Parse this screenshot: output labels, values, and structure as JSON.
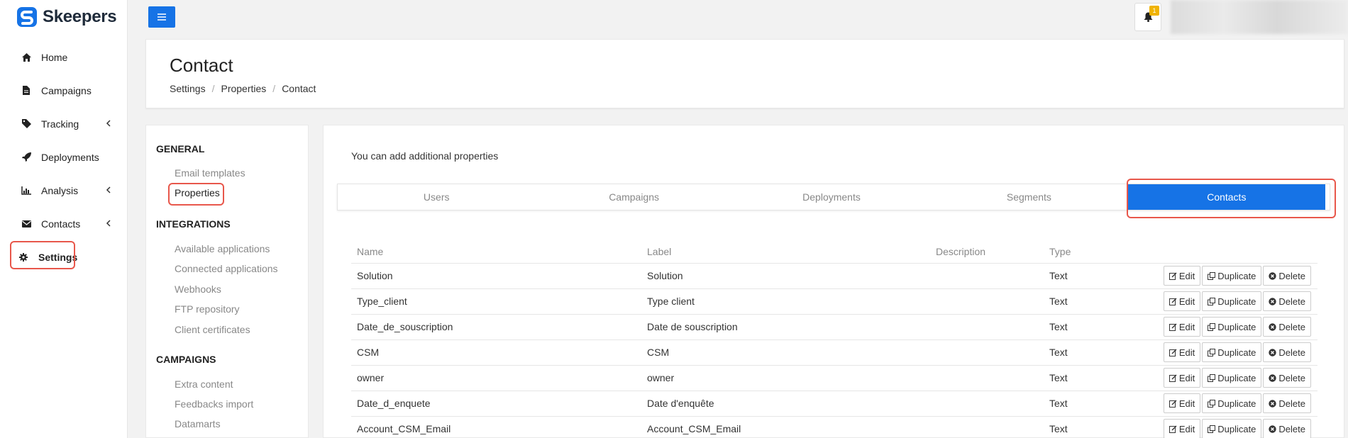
{
  "app": {
    "brand": "Skeepers",
    "accent": "#1673e6",
    "highlight": "#e8574b"
  },
  "sidebar": {
    "items": [
      {
        "label": "Home",
        "icon": "home-icon"
      },
      {
        "label": "Campaigns",
        "icon": "file-icon"
      },
      {
        "label": "Tracking",
        "icon": "tag-icon",
        "expandable": true
      },
      {
        "label": "Deployments",
        "icon": "rocket-icon"
      },
      {
        "label": "Analysis",
        "icon": "bar-chart-icon",
        "expandable": true
      },
      {
        "label": "Contacts",
        "icon": "envelope-icon",
        "expandable": true
      },
      {
        "label": "Settings",
        "icon": "gear-icon",
        "active": true
      }
    ]
  },
  "topbar": {
    "notifications_count": "1"
  },
  "page": {
    "title": "Contact",
    "breadcrumb": [
      "Settings",
      "Properties",
      "Contact"
    ]
  },
  "submenu": {
    "sections": [
      {
        "title": "GENERAL",
        "links": [
          "Email templates",
          "Properties"
        ]
      },
      {
        "title": "INTEGRATIONS",
        "links": [
          "Available applications",
          "Connected applications",
          "Webhooks",
          "FTP repository",
          "Client certificates"
        ]
      },
      {
        "title": "CAMPAIGNS",
        "links": [
          "Extra content",
          "Feedbacks import",
          "Datamarts"
        ]
      }
    ],
    "active": "Properties"
  },
  "main": {
    "intro": "You can add additional properties",
    "tabs": [
      "Users",
      "Campaigns",
      "Deployments",
      "Segments",
      "Contacts"
    ],
    "active_tab": "Contacts",
    "table": {
      "headers": [
        "Name",
        "Label",
        "Description",
        "Type"
      ],
      "rows": [
        {
          "name": "Solution",
          "label": "Solution",
          "description": "",
          "type": "Text"
        },
        {
          "name": "Type_client",
          "label": "Type client",
          "description": "",
          "type": "Text"
        },
        {
          "name": "Date_de_souscription",
          "label": "Date de souscription",
          "description": "",
          "type": "Text"
        },
        {
          "name": "CSM",
          "label": "CSM",
          "description": "",
          "type": "Text"
        },
        {
          "name": "owner",
          "label": "owner",
          "description": "",
          "type": "Text"
        },
        {
          "name": "Date_d_enquete",
          "label": "Date d'enquête",
          "description": "",
          "type": "Text"
        },
        {
          "name": "Account_CSM_Email",
          "label": "Account_CSM_Email",
          "description": "",
          "type": "Text"
        }
      ],
      "actions": {
        "edit": "Edit",
        "duplicate": "Duplicate",
        "delete": "Delete"
      }
    }
  }
}
